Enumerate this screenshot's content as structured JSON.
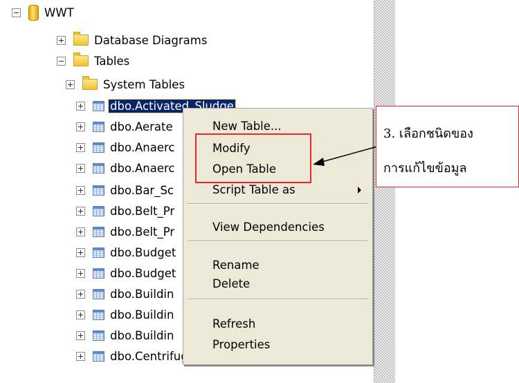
{
  "tree": {
    "root": {
      "label": "WWT",
      "expander": "minus",
      "icon": "database-icon"
    },
    "folders": [
      {
        "label": "Database Diagrams",
        "expander": "plus",
        "icon": "folder-icon"
      },
      {
        "label": "Tables",
        "expander": "minus",
        "icon": "folder-icon"
      }
    ],
    "subfolders": [
      {
        "label": "System Tables",
        "expander": "plus",
        "icon": "folder-icon"
      }
    ],
    "tables": [
      {
        "label": "dbo.Activated_Sludge",
        "selected": true
      },
      {
        "label": "dbo.Aerate"
      },
      {
        "label": "dbo.Anaerc"
      },
      {
        "label": "dbo.Anaerc"
      },
      {
        "label": "dbo.Bar_Sc"
      },
      {
        "label": "dbo.Belt_Pr"
      },
      {
        "label": "dbo.Belt_Pr"
      },
      {
        "label": "dbo.Budget"
      },
      {
        "label": "dbo.Budget"
      },
      {
        "label": "dbo.Buildin"
      },
      {
        "label": "dbo.Buildin"
      },
      {
        "label": "dbo.Buildin"
      },
      {
        "label": "dbo.Centrifuge_M"
      }
    ]
  },
  "context_menu": {
    "items": [
      {
        "label": "New Table..."
      },
      {
        "label": "Modify"
      },
      {
        "label": "Open Table"
      },
      {
        "label": "Script Table as",
        "submenu": true
      },
      {
        "label": "View Dependencies"
      },
      {
        "label": "Rename"
      },
      {
        "label": "Delete"
      },
      {
        "label": "Refresh"
      },
      {
        "label": "Properties"
      }
    ]
  },
  "callout": {
    "line1": "3. เลือกชนิดของ",
    "line2": "การแก้ไขข้อมูล"
  },
  "colors": {
    "selection": "#0a246a",
    "annotation_red": "#e8262b",
    "menu_background": "#ece9d8"
  }
}
